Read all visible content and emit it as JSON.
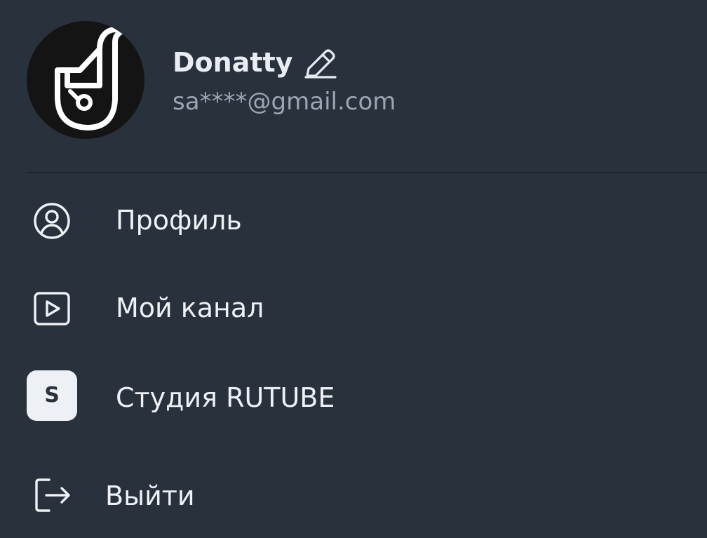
{
  "user": {
    "name": "Donatty",
    "email": "sa****@gmail.com"
  },
  "menu": {
    "items": [
      {
        "id": "profile",
        "label": "Профиль",
        "icon": "user-circle-icon"
      },
      {
        "id": "my-channel",
        "label": "Мой канал",
        "icon": "play-square-icon"
      },
      {
        "id": "studio",
        "label": "Студия RUTUBE",
        "icon": "studio-s-badge-icon",
        "badge": "S"
      },
      {
        "id": "logout",
        "label": "Выйти",
        "icon": "logout-icon"
      }
    ]
  },
  "icons": {
    "edit": "pencil-icon",
    "avatar": "donatty-logo-icon"
  },
  "colors": {
    "background": "#28313c",
    "divider": "#1f262f",
    "text_primary": "#eef1f5",
    "text_secondary": "#9aa6b4",
    "badge_bg": "#edf0f4"
  }
}
